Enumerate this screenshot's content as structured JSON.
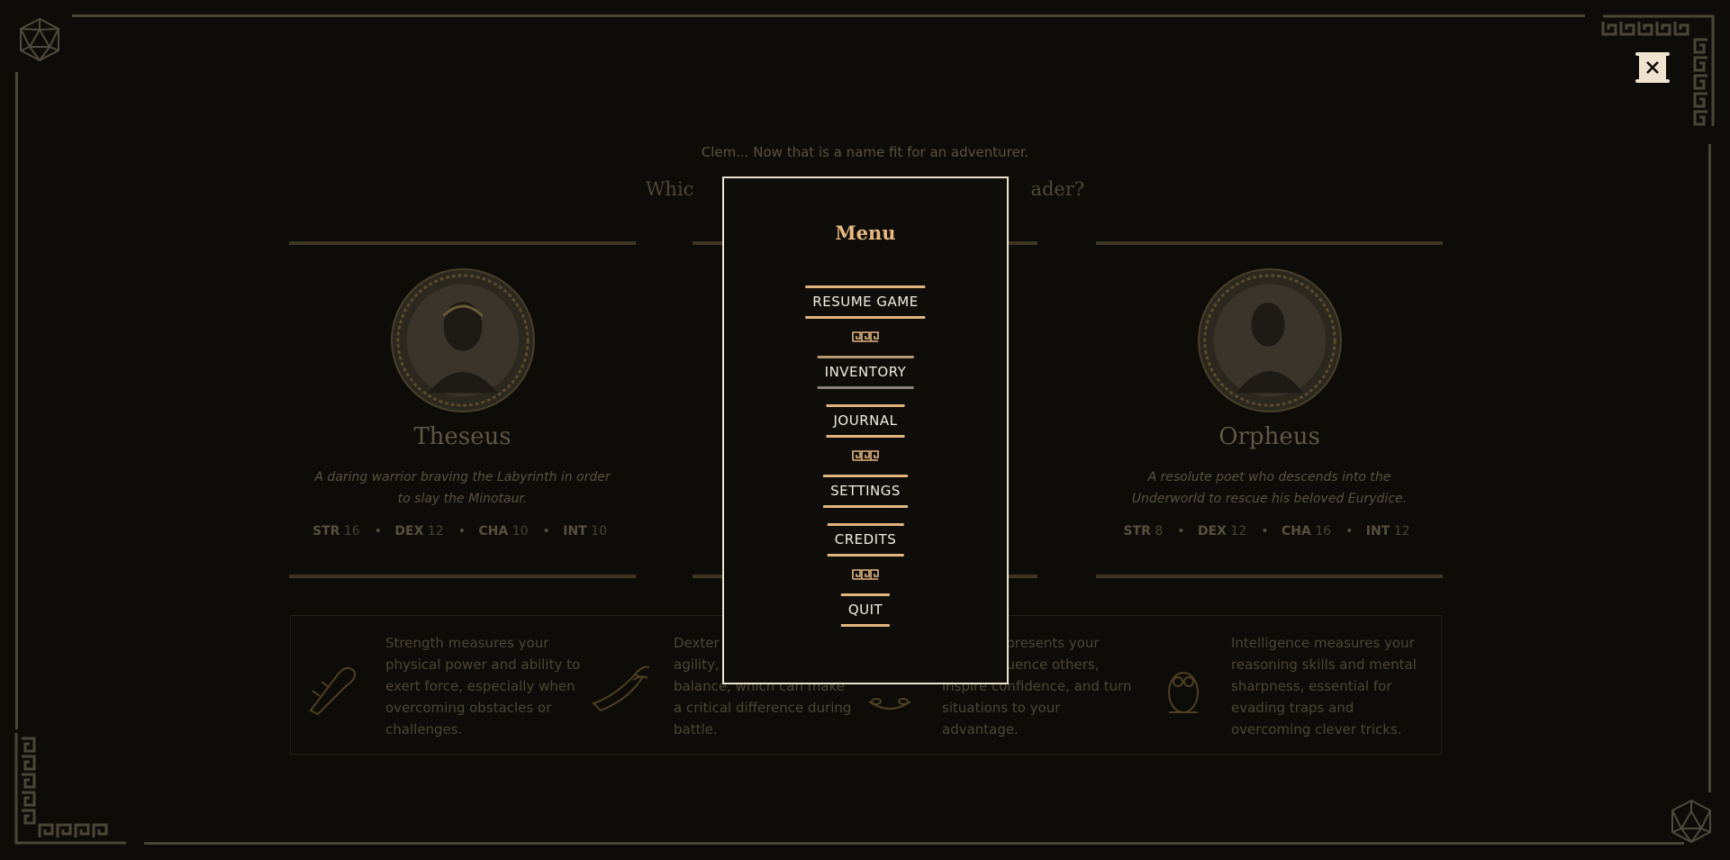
{
  "game": {
    "intro_text": "Clem... Now that is a name fit for an adventurer.",
    "question_text": "Whic",
    "question_text_end": "ader?"
  },
  "icons": {
    "d20": "d20-dice-icon",
    "close": "scroll-close-icon",
    "meander": "greek-key-icon"
  },
  "cards": [
    {
      "name": "Theseus",
      "description": "A daring warrior braving the Labyrinth in order to slay the Minotaur.",
      "stats": [
        {
          "label": "STR",
          "value": "16"
        },
        {
          "label": "DEX",
          "value": "12"
        },
        {
          "label": "CHA",
          "value": "10"
        },
        {
          "label": "INT",
          "value": "10"
        }
      ]
    },
    {
      "name": "Orpheus",
      "description": "A resolute poet who descends into the Underworld to rescue his beloved Eurydice.",
      "stats": [
        {
          "label": "STR",
          "value": "8"
        },
        {
          "label": "DEX",
          "value": "12"
        },
        {
          "label": "CHA",
          "value": "16"
        },
        {
          "label": "INT",
          "value": "12"
        }
      ]
    }
  ],
  "info": [
    {
      "icon": "club-icon",
      "text": "Strength measures your physical power and ability to exert force, especially when overcoming obstacles or challenges."
    },
    {
      "icon": "winged-sandal-icon",
      "text": "Dexter"
    },
    {
      "icon": "laurel-icon",
      "text": "epresents your"
    },
    {
      "icon": "owl-icon",
      "text": "Intelligence measures your reasoning skills and mental sharpness, essential for evading traps and overcoming clever tricks."
    }
  ],
  "info_fragments": {
    "dex_line2": "agility, b",
    "dex_line3": "balance, which can make",
    "dex_line4": "a critical difference during",
    "dex_line5": "battle.",
    "cha_line2": "fluence others,",
    "cha_line3": "inspire confidence, and turn",
    "cha_line4": "situations to your",
    "cha_line5": "advantage."
  },
  "menu": {
    "title": "Menu",
    "items": [
      "RESUME GAME",
      "INVENTORY",
      "JOURNAL",
      "SETTINGS",
      "CREDITS",
      "QUIT"
    ]
  },
  "colors": {
    "background": "#0d0c08",
    "accent": "#e2b57e",
    "menu_border": "#efe3cf",
    "text": "#f3eee3"
  }
}
